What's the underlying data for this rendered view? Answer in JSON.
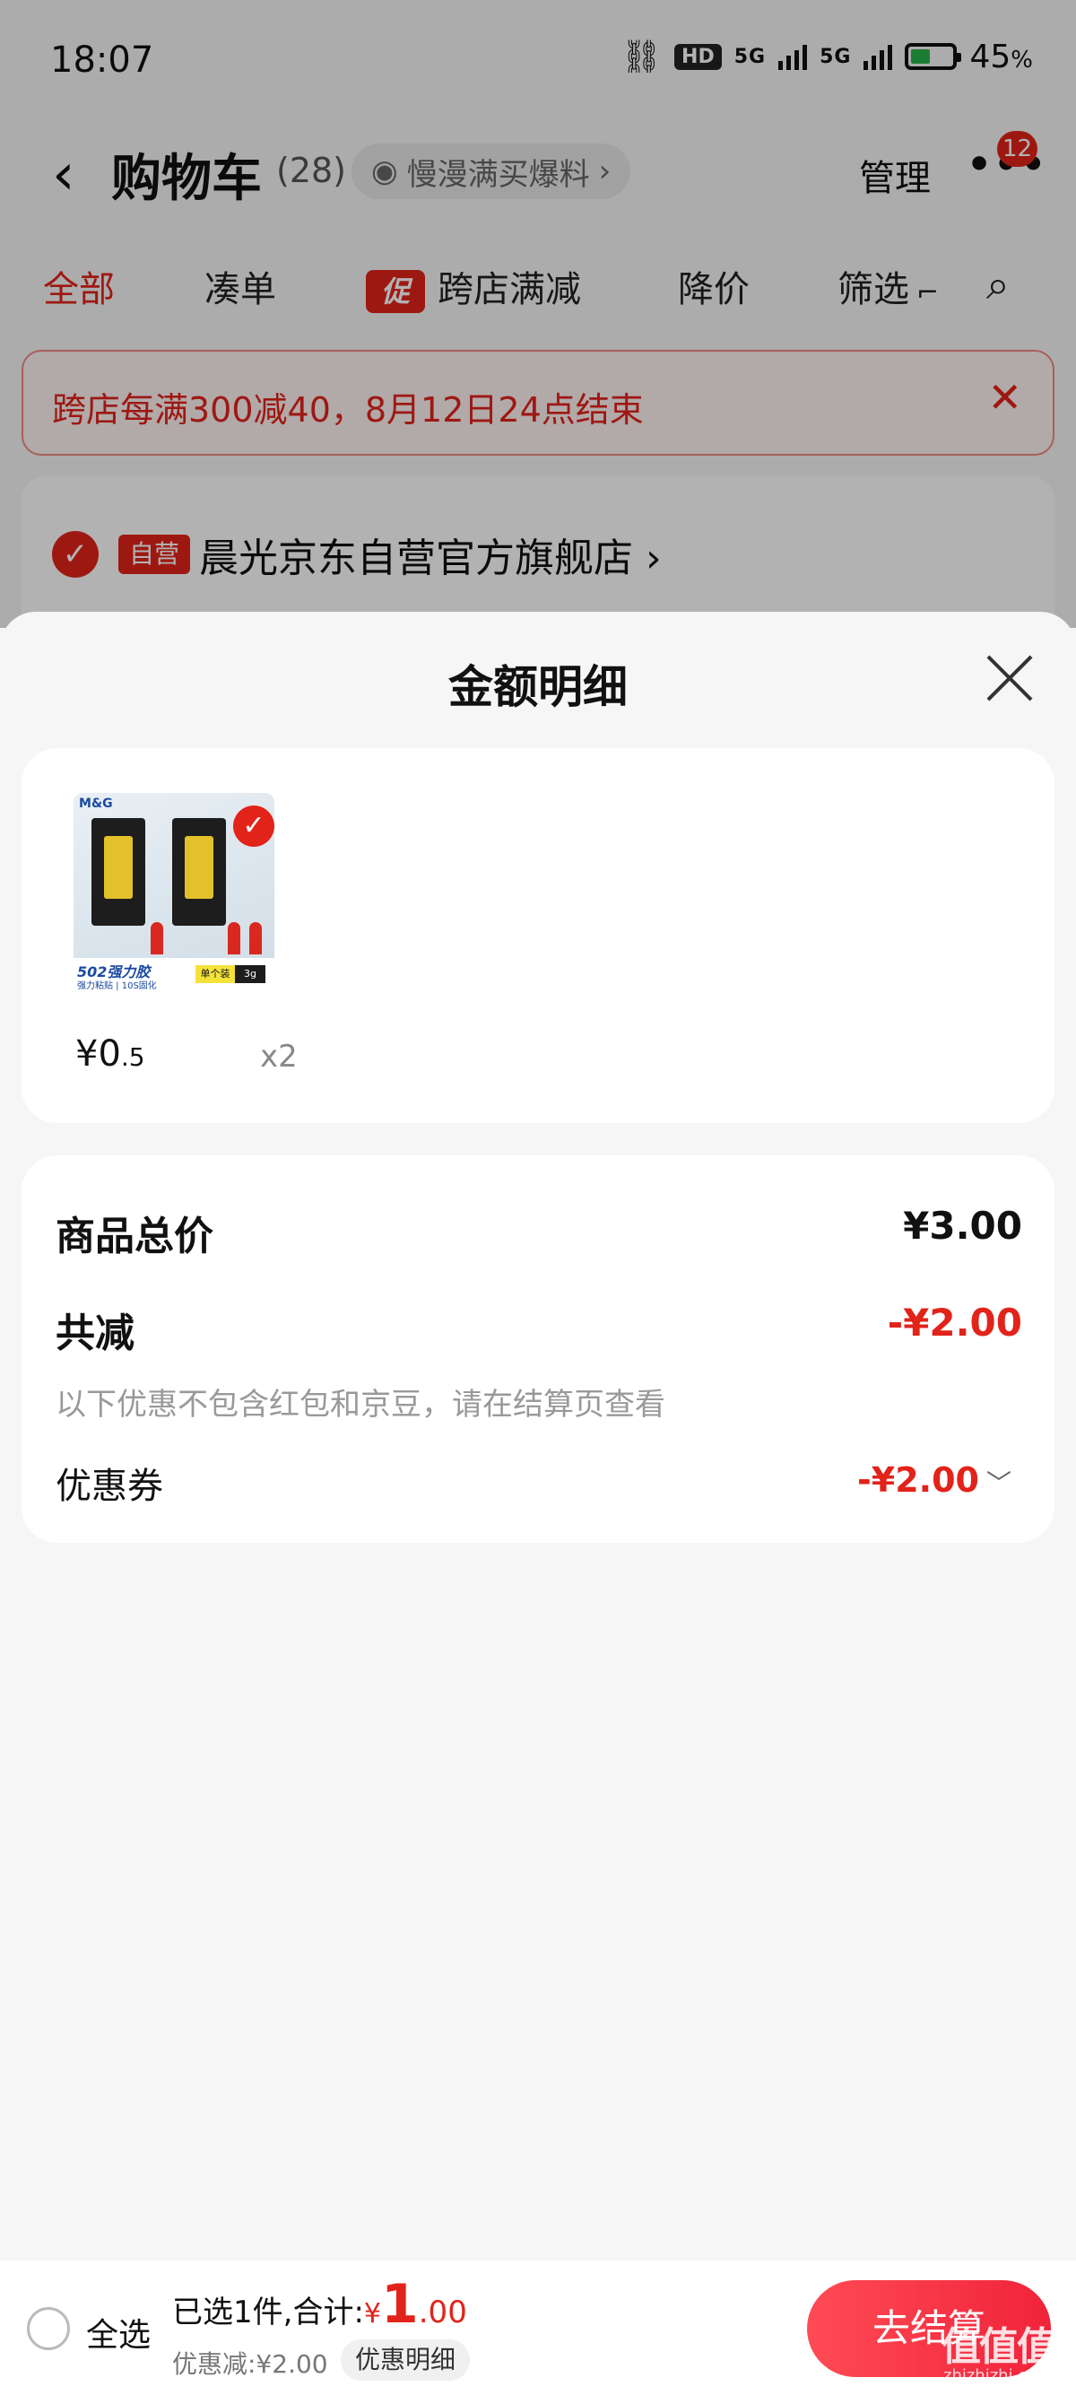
{
  "status_bar": {
    "time": "18:07",
    "hd_label": "HD",
    "signal1": "5G",
    "signal2": "5G",
    "battery_level": 0.45,
    "battery_text": "45",
    "battery_unit": "%"
  },
  "navbar": {
    "back_icon": "‹",
    "title": "购物车",
    "count": "(28)",
    "promo_text": "慢漫满买爆料",
    "manage": "管理",
    "more_icon": "•••",
    "badge": "12"
  },
  "tabs": [
    {
      "label": "全部",
      "active": true
    },
    {
      "label": "凑单"
    },
    {
      "label": "跨店满减",
      "tag": "促"
    },
    {
      "label": "降价"
    },
    {
      "label": "筛选"
    }
  ],
  "notice": {
    "text": "跨店每满300减40，8月12日24点结束",
    "close_icon": "✕"
  },
  "store": {
    "tag": "自营",
    "name": "晨光京东自营官方旗舰店"
  },
  "sheet": {
    "title": "金额明细",
    "product": {
      "price_symbol": "¥",
      "price_int": "0",
      "price_dec": ".5",
      "qty": "x2",
      "image_brand": "M&G",
      "image_label": "502强力胶",
      "image_sub": "强力粘贴 | 10S固化",
      "image_tag": "单个装",
      "image_size": "3g"
    },
    "summary": {
      "total_label": "商品总价",
      "total_value": "¥3.00",
      "discount_label": "共减",
      "discount_value": "-¥2.00",
      "discount_note": "以下优惠不包含红包和京豆，请在结算页查看",
      "coupon_label": "优惠券",
      "coupon_value": "-¥2.00"
    }
  },
  "bottom": {
    "select_all": "全选",
    "selected_text": "已选1件,合计:",
    "total_symbol": "¥",
    "total_int": "1",
    "total_dec": ".00",
    "discount_text": "优惠减:¥2.00",
    "detail_button": "优惠明细",
    "checkout": "去结算"
  },
  "watermark": {
    "text": "值值值",
    "sub": "zhizhizhi.com"
  },
  "colors": {
    "accent": "#e2231a",
    "checkout": "#f0233a"
  }
}
